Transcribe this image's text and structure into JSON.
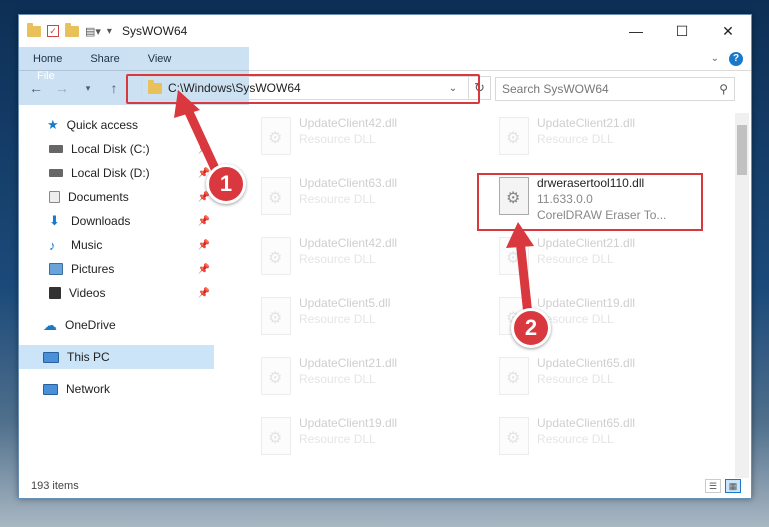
{
  "window": {
    "title": "SysWOW64",
    "minimize": "—",
    "maximize": "☐",
    "close": "✕"
  },
  "ribbon": {
    "tabs": [
      "File",
      "Home",
      "Share",
      "View"
    ]
  },
  "address": {
    "path": "C:\\Windows\\SysWOW64"
  },
  "search": {
    "placeholder": "Search SysWOW64"
  },
  "sidebar": {
    "quick_access": "Quick access",
    "items": [
      {
        "label": "Local Disk (C:)",
        "pinned": true
      },
      {
        "label": "Local Disk (D:)",
        "pinned": true
      },
      {
        "label": "Documents",
        "pinned": true
      },
      {
        "label": "Downloads",
        "pinned": true
      },
      {
        "label": "Music",
        "pinned": true
      },
      {
        "label": "Pictures",
        "pinned": true
      },
      {
        "label": "Videos",
        "pinned": true
      }
    ],
    "onedrive": "OneDrive",
    "this_pc": "This PC",
    "network": "Network"
  },
  "files": {
    "col1": [
      {
        "name": "UpdateClient42.dll",
        "type": "Resource DLL"
      },
      {
        "name": "UpdateClient63.dll",
        "type": "Resource DLL"
      },
      {
        "name": "UpdateClient42.dll",
        "type": "Resource DLL"
      },
      {
        "name": "UpdateClient5.dll",
        "type": "Resource DLL"
      },
      {
        "name": "UpdateClient21.dll",
        "type": "Resource DLL"
      },
      {
        "name": "UpdateClient19.dll",
        "type": "Resource DLL"
      }
    ],
    "col2": [
      {
        "name": "UpdateClient21.dll",
        "type": "Resource DLL"
      },
      {
        "name": "UpdateClient21.dll",
        "type": "Resource DLL"
      },
      {
        "name": "UpdateClient19.dll",
        "type": "Resource DLL"
      },
      {
        "name": "UpdateClient65.dll",
        "type": "Resource DLL"
      },
      {
        "name": "UpdateClient65.dll",
        "type": "Resource DLL"
      }
    ],
    "highlight": {
      "name": "drwerasertool110.dll",
      "version": "11.633.0.0",
      "desc": "CorelDRAW Eraser To..."
    }
  },
  "status": {
    "count": "193 items"
  },
  "annotations": {
    "step1": "1",
    "step2": "2",
    "color": "#d9383e"
  }
}
